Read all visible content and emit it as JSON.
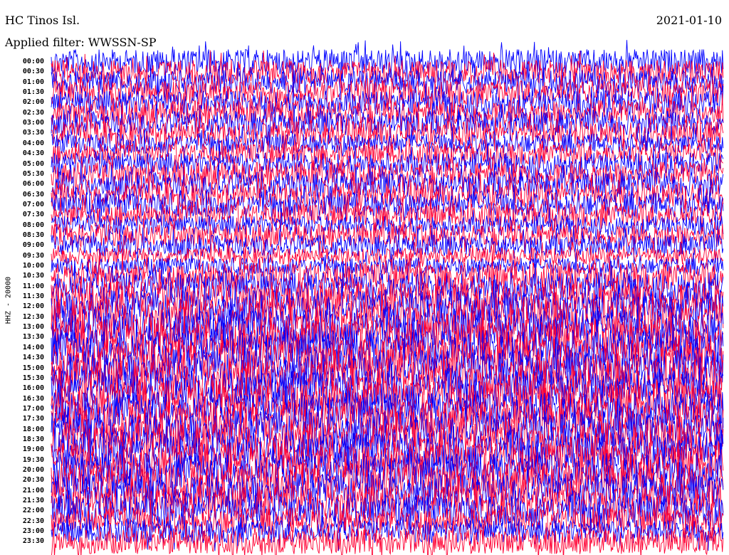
{
  "header": {
    "station": "HC Tinos Isl.",
    "date": "2021-01-10",
    "filter": "Applied filter: WWSSN-SP"
  },
  "chart_data": {
    "type": "line",
    "title": "HC Tinos Isl.",
    "ylabel": "HHZ - 20000",
    "series_colors": [
      "#0000ff",
      "#ff0033"
    ],
    "time_labels": [
      "00:00",
      "00:30",
      "01:00",
      "01:30",
      "02:00",
      "02:30",
      "03:00",
      "03:30",
      "04:00",
      "04:30",
      "05:00",
      "05:30",
      "06:00",
      "06:30",
      "07:00",
      "07:30",
      "08:00",
      "08:30",
      "09:00",
      "09:30",
      "10:00",
      "10:30",
      "11:00",
      "11:30",
      "12:00",
      "12:30",
      "13:00",
      "13:30",
      "14:00",
      "14:30",
      "15:00",
      "15:30",
      "16:00",
      "16:30",
      "17:00",
      "17:30",
      "18:00",
      "18:30",
      "19:00",
      "19:30",
      "20:00",
      "20:30",
      "21:00",
      "21:30",
      "22:00",
      "22:30",
      "23:00",
      "23:30"
    ],
    "amplitude_level": [
      0.62,
      0.6,
      0.6,
      0.6,
      0.6,
      0.62,
      0.6,
      0.6,
      0.45,
      0.5,
      0.55,
      0.6,
      0.62,
      0.6,
      0.58,
      0.55,
      0.45,
      0.55,
      0.5,
      0.35,
      0.35,
      0.7,
      0.75,
      0.8,
      0.85,
      1.0,
      1.0,
      1.0,
      1.0,
      1.0,
      1.0,
      1.0,
      1.0,
      1.0,
      0.9,
      0.95,
      1.0,
      0.95,
      0.95,
      0.95,
      0.95,
      0.95,
      0.9,
      0.85,
      0.8,
      0.7,
      0.55,
      0.6
    ]
  }
}
